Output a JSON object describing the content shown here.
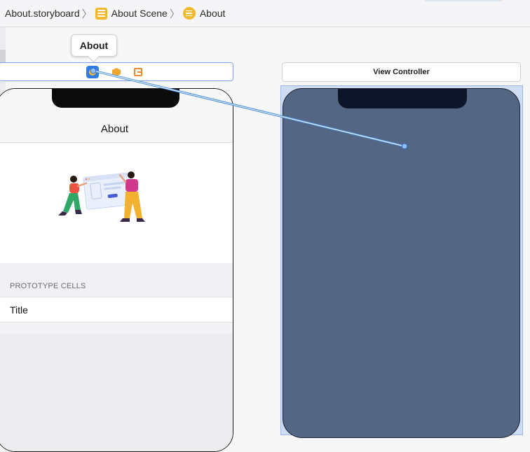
{
  "breadcrumb": {
    "items": [
      {
        "label": "About.storyboard",
        "icon": "storyboard-file-icon"
      },
      {
        "label": "About Scene",
        "icon": "scene-icon"
      },
      {
        "label": "About",
        "icon": "view-controller-icon"
      }
    ],
    "separator": "〉"
  },
  "tooltip": {
    "text": "About"
  },
  "left_scene": {
    "dock_icons": [
      "view-controller-icon",
      "first-responder-icon",
      "exit-icon"
    ],
    "nav_title": "About",
    "section_header": "PROTOTYPE CELLS",
    "cell_title": "Title"
  },
  "right_scene": {
    "dock_label": "View Controller"
  },
  "colors": {
    "accent": "#2f7de1",
    "connection_line": "#4a90e2",
    "right_view_background": "#536683",
    "selection_highlight": "#cfdcf3",
    "scene_icon": "#f2b92c"
  }
}
